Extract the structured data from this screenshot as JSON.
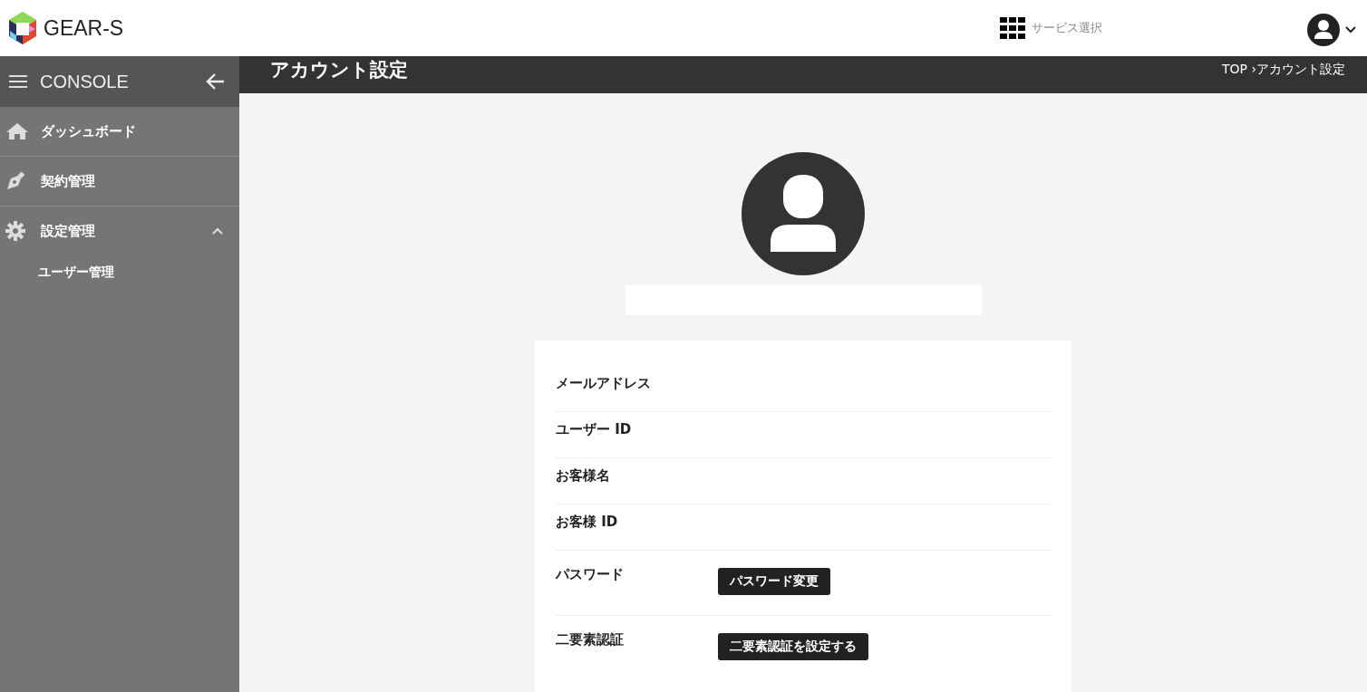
{
  "header": {
    "logo_text": "GEAR-S",
    "service_select": "サービス選択"
  },
  "sidebar": {
    "title": "CONSOLE",
    "items": [
      {
        "label": "ダッシュボード",
        "kind": "home"
      },
      {
        "label": "契約管理",
        "kind": "pen"
      },
      {
        "label": "設定管理",
        "kind": "gear",
        "expanded": true,
        "children": [
          {
            "label": "ユーザー管理"
          }
        ]
      }
    ]
  },
  "page": {
    "title": "アカウント設定",
    "breadcrumb": "TOP ›アカウント設定"
  },
  "account": {
    "rows": [
      {
        "label": "メールアドレス"
      },
      {
        "label": "ユーザー ID"
      },
      {
        "label": "お客様名"
      },
      {
        "label": "お客様 ID"
      },
      {
        "label": "パスワード",
        "button": "パスワード変更"
      },
      {
        "label": "二要素認証",
        "button": "二要素認証を設定する"
      }
    ]
  }
}
